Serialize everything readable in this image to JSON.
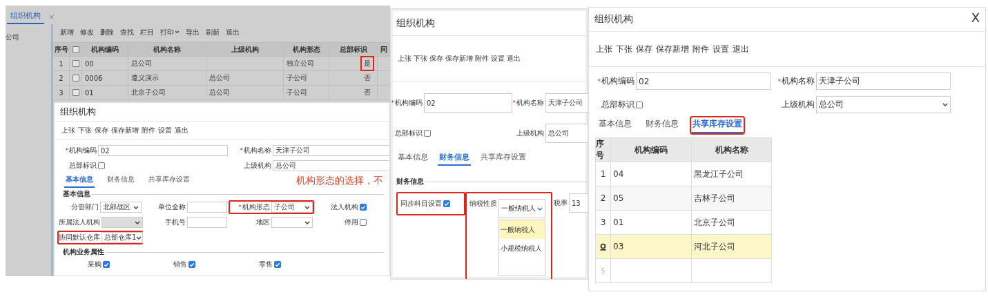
{
  "back_window": {
    "tab": {
      "label": "组织机构",
      "close": "×",
      "selected": true
    },
    "sidebar_items": [
      "公司"
    ],
    "toolbar": [
      {
        "label": "新增",
        "dropdown": false
      },
      {
        "label": "修改",
        "dropdown": false
      },
      {
        "label": "删除",
        "dropdown": false
      },
      {
        "label": "查找",
        "dropdown": false
      },
      {
        "label": "栏目",
        "dropdown": false
      },
      {
        "label": "打印",
        "dropdown": true
      },
      {
        "label": "导出",
        "dropdown": false
      },
      {
        "label": "刷新",
        "dropdown": false
      },
      {
        "label": "退出",
        "dropdown": false
      }
    ],
    "table": {
      "columns": [
        {
          "kind": "text",
          "label": "序号"
        },
        {
          "kind": "checkbox",
          "checked": false
        },
        {
          "kind": "text",
          "label": "机构编码"
        },
        {
          "kind": "text",
          "label": "机构名称"
        },
        {
          "kind": "text",
          "label": "上级机构"
        },
        {
          "kind": "text",
          "label": "机构形态"
        },
        {
          "kind": "text",
          "label": "总部标识"
        },
        {
          "kind": "text",
          "label": "同"
        }
      ],
      "rows": [
        {
          "no": "1",
          "checked": false,
          "code": "00",
          "name": "总公司",
          "form": "独立公司",
          "hq": "是",
          "flagged": true
        },
        {
          "no": "2",
          "checked": false,
          "code": "0006",
          "name": "遵义演示",
          "parent": "总公司",
          "form": "子公司",
          "hq": "否",
          "flagged": false
        },
        {
          "no": "3",
          "checked": false,
          "code": "01",
          "name": "北京子公司",
          "parent": "总公司",
          "form": "子公司",
          "hq": "否",
          "flagged": false
        }
      ]
    }
  },
  "dialogs": [
    {
      "kind": "basic",
      "title": "组织机构",
      "toolbar": [
        "上张",
        "下张",
        "保存",
        "保存新增",
        "附件",
        "设置",
        "退出"
      ],
      "header": [
        {
          "kind": "input",
          "label": "机构编码",
          "mark": "*",
          "value": "02"
        },
        {
          "kind": "input",
          "label": "机构名称",
          "mark": "*",
          "value": "天津子公司"
        },
        {
          "kind": "checkbox",
          "label": "总部标识",
          "checked": false
        },
        {
          "kind": "input",
          "label": "上级机构",
          "value": "总公司"
        }
      ],
      "tabs": [
        {
          "label": "基本信息",
          "selected": true
        },
        {
          "label": "财务信息",
          "selected": false
        },
        {
          "label": "共享库存设置",
          "selected": false
        }
      ],
      "sections": [
        {
          "title": "基本信息",
          "fields": [
            {
              "kind": "select",
              "label": "分管部门",
              "value": "北部战区",
              "disabled": false,
              "flagged": false
            },
            {
              "kind": "input",
              "label": "单位全称",
              "flagged": false
            },
            {
              "kind": "select",
              "label": "机构形态",
              "mark": "*",
              "value": "子公司",
              "disabled": false,
              "flagged": true
            },
            {
              "kind": "checkbox",
              "label": "法人机构",
              "checked": true,
              "flagged": false
            },
            {
              "kind": "select",
              "label": "所属法人机构",
              "disabled": true,
              "flagged": false
            },
            {
              "kind": "input",
              "label": "手机号",
              "flagged": false
            },
            {
              "kind": "select",
              "label": "地区",
              "disabled": false,
              "flagged": false
            },
            {
              "kind": "checkbox",
              "label": "停用",
              "checked": false,
              "flagged": false
            },
            {
              "kind": "select",
              "label": "协同默认仓库",
              "value": "总部仓库1",
              "disabled": false,
              "flagged": true
            }
          ]
        },
        {
          "title": "机构业务属性",
          "fields": [
            {
              "kind": "checkbox",
              "label": "采购",
              "checked": true,
              "flagged": false
            },
            {
              "kind": "checkbox",
              "label": "销售",
              "checked": true,
              "flagged": false
            },
            {
              "kind": "checkbox",
              "label": "零售",
              "checked": true,
              "flagged": false
            }
          ]
        }
      ],
      "annotation": "机构形态的选择，不"
    },
    {
      "kind": "finance",
      "title": "组织机构",
      "toolbar": [
        "上张",
        "下张",
        "保存",
        "保存新增",
        "附件",
        "设置",
        "退出"
      ],
      "header": [
        {
          "kind": "input",
          "label": "机构编码",
          "mark": "*",
          "value": "02"
        },
        {
          "kind": "input",
          "label": "机构名称",
          "mark": "*",
          "value": "天津子公司"
        },
        {
          "kind": "checkbox",
          "label": "总部标识",
          "checked": false
        },
        {
          "kind": "input",
          "label": "上级机构",
          "value": "总公司"
        }
      ],
      "tabs": [
        {
          "label": "基本信息",
          "selected": false
        },
        {
          "label": "财务信息",
          "selected": true
        },
        {
          "label": "共享库存设置",
          "selected": false
        }
      ],
      "sections": [
        {
          "title": "财务信息",
          "fields": [
            {
              "kind": "checkbox",
              "label": "同步科目设置",
              "checked": true,
              "flagged": true
            },
            {
              "kind": "select",
              "label": "纳税性质",
              "value": "一般纳税人",
              "disabled": false,
              "flagged": true,
              "open": true,
              "options": [
                {
                  "label": "一般纳税人",
                  "selected": true
                },
                {
                  "label": "小规模纳税人",
                  "selected": false
                }
              ]
            },
            {
              "kind": "select",
              "label": "税率",
              "value": "13",
              "disabled": false,
              "flagged": false,
              "open": false
            }
          ]
        }
      ]
    },
    {
      "kind": "stock",
      "title": "组织机构",
      "close": "X",
      "toolbar": [
        "上张",
        "下张",
        "保存",
        "保存新增",
        "附件",
        "设置",
        "退出"
      ],
      "header": [
        {
          "kind": "input",
          "label": "机构编码",
          "mark": "*",
          "value": "02"
        },
        {
          "kind": "input",
          "label": "机构名称",
          "mark": "*",
          "value": "天津子公司"
        },
        {
          "kind": "checkbox",
          "label": "总部标识",
          "checked": false
        },
        {
          "kind": "select",
          "label": "上级机构",
          "value": "总公司"
        }
      ],
      "tabs": [
        {
          "label": "基本信息",
          "selected": false,
          "flagged": false
        },
        {
          "label": "财务信息",
          "selected": false,
          "flagged": false
        },
        {
          "label": "共享库存设置",
          "selected": true,
          "flagged": true
        }
      ],
      "table": {
        "columns": [
          "序号",
          "机构编码",
          "机构名称"
        ],
        "rows": [
          {
            "no": "1",
            "code": "04",
            "name": "黑龙江子公司",
            "selected": false
          },
          {
            "no": "2",
            "code": "05",
            "name": "吉林子公司",
            "selected": false
          },
          {
            "no": "3",
            "code": "01",
            "name": "北京子公司",
            "selected": false
          },
          {
            "code": "03",
            "name": "河北子公司",
            "selected": true
          },
          {
            "no": "5",
            "selected": false
          }
        ]
      }
    }
  ]
}
